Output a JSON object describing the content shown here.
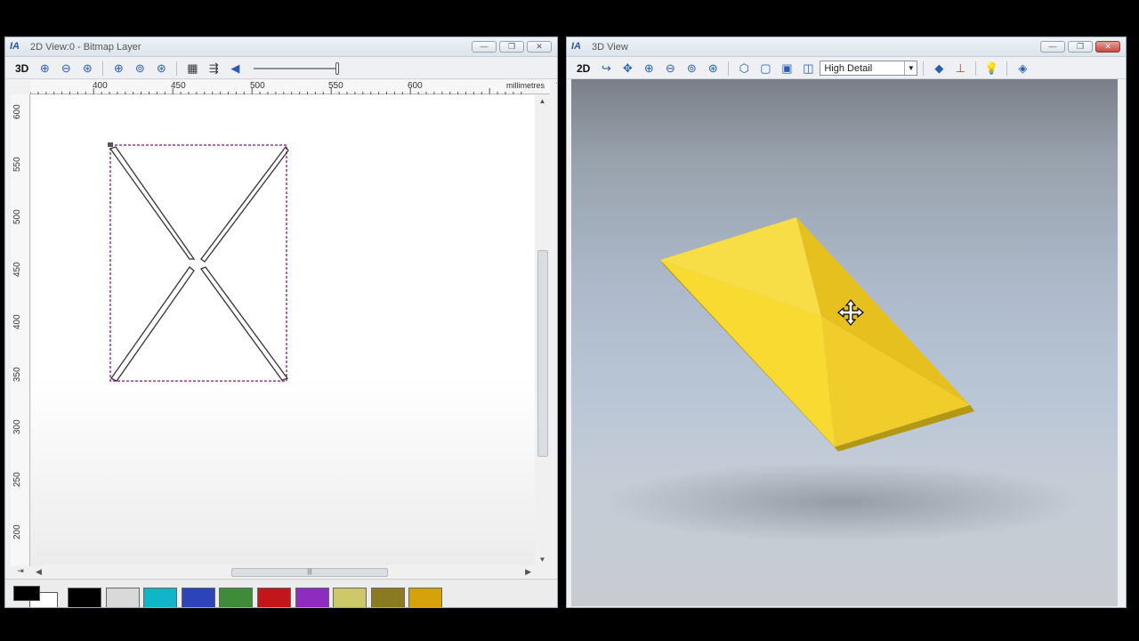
{
  "left_window": {
    "title": "2D View:0 - Bitmap Layer",
    "toolbar_mode": "3D",
    "ruler_top_labels": [
      "400",
      "450",
      "500",
      "550",
      "600"
    ],
    "ruler_units": "millimetres",
    "ruler_left_labels": [
      "600",
      "550",
      "500",
      "450",
      "400",
      "350",
      "300",
      "250",
      "200"
    ],
    "palette": {
      "current_color": "#000000",
      "swatches": [
        "#000000",
        "#d9d9d9",
        "#12b5c7",
        "#2d43b8",
        "#3e8c3a",
        "#c2161a",
        "#8e2cc0",
        "#cdc96a",
        "#8a7a22",
        "#d6a20a"
      ]
    }
  },
  "right_window": {
    "title": "3D View",
    "toolbar_mode": "2D",
    "detail_select": "High Detail",
    "model_color": "#f5d01e"
  }
}
